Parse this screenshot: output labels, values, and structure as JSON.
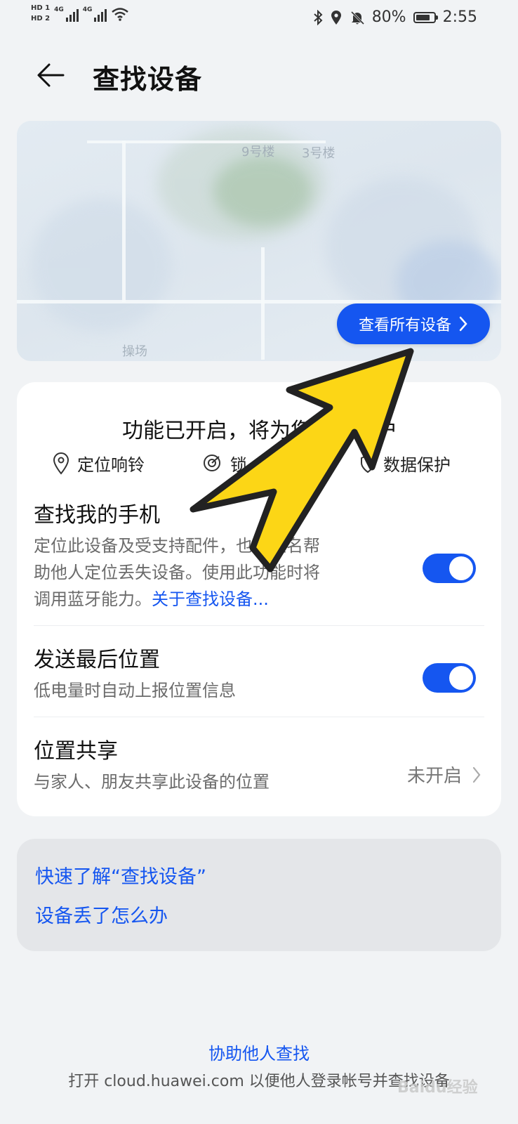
{
  "status_bar": {
    "hd1": "HD 1",
    "hd2": "HD 2",
    "net1": "4G",
    "net2": "4G",
    "battery_percent": "80%",
    "time": "2:55",
    "battery_level": 0.8
  },
  "header": {
    "title": "查找设备"
  },
  "map": {
    "labels": [
      "9号楼",
      "3号楼",
      "操场"
    ],
    "view_all_button": "查看所有设备"
  },
  "card": {
    "status_text": "功能已开启，将为您提供保护",
    "features": [
      "定位响铃",
      "锁",
      "数据保护"
    ],
    "find_phone": {
      "title": "查找我的手机",
      "desc_line1": "定位此设备及受支持配件，也可匿名帮",
      "desc_line2": "助他人定位丢失设备。使用此功能时将",
      "desc_line3": "调用蓝牙能力。",
      "link": "关于查找设备...",
      "enabled": true
    },
    "last_location": {
      "title": "发送最后位置",
      "desc": "低电量时自动上报位置信息",
      "enabled": true
    },
    "location_share": {
      "title": "位置共享",
      "desc": "与家人、朋友共享此设备的位置",
      "status": "未开启"
    }
  },
  "help": {
    "link1": "快速了解“查找设备”",
    "link2": "设备丢了怎么办"
  },
  "footer": {
    "link": "协助他人查找",
    "text": "打开 cloud.huawei.com 以便他人登录帐号并查找设备",
    "watermark": "Baidu经验"
  },
  "colors": {
    "accent": "#1556f0",
    "arrow_fill": "#fcd616",
    "arrow_stroke": "#222222"
  }
}
